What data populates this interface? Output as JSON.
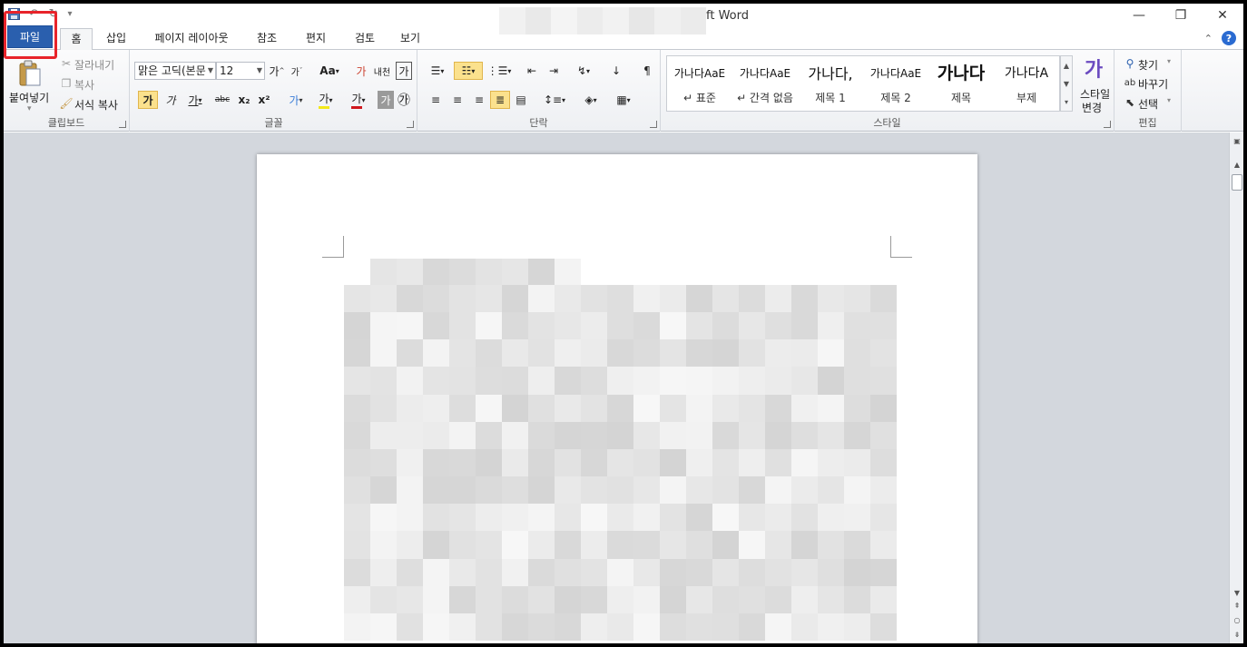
{
  "window": {
    "title_suffix": "ft Word",
    "controls": {
      "minimize": "—",
      "restore": "❐",
      "close": "✕"
    }
  },
  "quick_access": {
    "save_icon": "save-icon",
    "undo": "↶",
    "redo": "↻",
    "customize": "▾"
  },
  "tabs": [
    {
      "label": "파일",
      "id": "file"
    },
    {
      "label": "홈",
      "id": "home"
    },
    {
      "label": "삽입",
      "id": "insert"
    },
    {
      "label": "페이지 레이아웃",
      "id": "layout"
    },
    {
      "label": "참조",
      "id": "references"
    },
    {
      "label": "편지",
      "id": "mailings"
    },
    {
      "label": "검토",
      "id": "review"
    },
    {
      "label": "보기",
      "id": "view"
    }
  ],
  "tab_right": {
    "collapse": "⌃",
    "help": "?"
  },
  "clipboard": {
    "label": "클립보드",
    "paste": "붙여넣기",
    "cut": "잘라내기",
    "copy": "복사",
    "format_painter": "서식 복사"
  },
  "font": {
    "label": "글꼴",
    "font_name": "맑은 고딕(본문",
    "font_size": "12",
    "grow": "가",
    "shrink": "가",
    "change_case": "Aa",
    "clear_format": "가",
    "phonetic": "내천",
    "char_border": "가",
    "bold": "가",
    "italic": "가",
    "underline": "가",
    "strike": "abc",
    "subscript": "x₂",
    "superscript": "x²",
    "text_effect": "가",
    "highlight": "가",
    "font_color": "가",
    "char_shading": "가",
    "enclosed": "㉮"
  },
  "paragraph": {
    "label": "단락"
  },
  "styles": {
    "label": "스타일",
    "items": [
      {
        "sample": "가나다AaE",
        "name": "↵ 표준"
      },
      {
        "sample": "가나다AaE",
        "name": "↵ 간격 없음"
      },
      {
        "sample": "가나다,",
        "name": "제목 1"
      },
      {
        "sample": "가나다AaE",
        "name": "제목 2"
      },
      {
        "sample": "가나다",
        "name": "제목"
      },
      {
        "sample": "가나다A",
        "name": "부제"
      }
    ],
    "change_style_icon": "가",
    "change_style_1": "스타일",
    "change_style_2": "변경"
  },
  "editing": {
    "label": "편집",
    "find": "찾기",
    "replace": "바꾸기",
    "select": "선택"
  },
  "colors": {
    "file_tab": "#2a5fae",
    "highlight_box": "#e8232a",
    "active_toggle": "#fbe18d",
    "doc_bg": "#d3d7dd"
  }
}
